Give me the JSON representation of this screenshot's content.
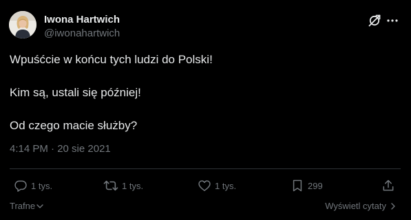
{
  "author": {
    "display_name": "Iwona Hartwich",
    "handle": "@iwonahartwich"
  },
  "icons": {
    "avatar": "profile-photo",
    "grok": "grok-icon",
    "more": "more-icon",
    "reply": "reply-icon",
    "retweet": "retweet-icon",
    "like": "heart-icon",
    "bookmark": "bookmark-icon",
    "share": "share-icon",
    "sort": "chevron-down-icon",
    "quotes": "chevron-right-icon"
  },
  "tweet": {
    "lines": [
      "Wpuśćcie w końcu tych ludzi do Polski!",
      "Kim są, ustali się później!",
      "Od czego macie służby?"
    ],
    "timestamp": "4:14 PM · 20 sie 2021"
  },
  "stats": {
    "replies": "1 tys.",
    "retweets": "1 tys.",
    "likes": "1 tys.",
    "bookmarks": "299"
  },
  "footer": {
    "sort_label": "Trafne",
    "quotes_label": "Wyświetl cytaty"
  },
  "colors": {
    "background": "#000000",
    "text_primary": "#e7e9ea",
    "text_secondary": "#71767b",
    "divider": "#2f3336"
  }
}
